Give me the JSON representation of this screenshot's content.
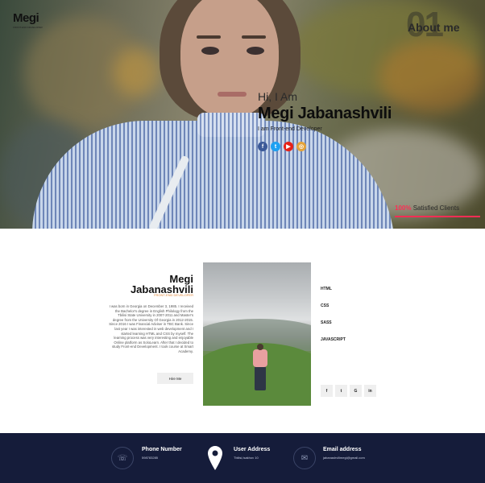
{
  "brand": {
    "name": "Megi",
    "subtitle": "FRONT-END DEVELOPER"
  },
  "hero": {
    "section_number": "01",
    "section_title": "About me",
    "greeting": "Hi, I Am",
    "name": "Megi Jabanashvili",
    "role": "I am Front-end Developer",
    "stat_value": "100%",
    "stat_label": "Satisfied Clients"
  },
  "social_icons": [
    "facebook-icon",
    "twitter-icon",
    "youtube-icon",
    "rss-icon"
  ],
  "about": {
    "name": "Megi Jabanashvili",
    "role": "FRONT-END DEVELOPER",
    "bio": "I was born in Georgia on December 3, 1985. I received the Bachelor's degree in English Philology from the Tbilisi State University in 2007-2011 and Master's degree from the University Of Georgia in 2012-2015. Since 2016 I was Financial Adviser in TBC Bank. Since last year I was interested in web development and I started learning HTML and CSS by myself. The learning process was very interesting and enjoyable Online platform as SoloLearn. After that I decided to study Front-end Development. I took course at Smart Academy.",
    "hire_label": "Hire Me",
    "skills": [
      "HTML",
      "CSS",
      "SASS",
      "JAVASCRIPT"
    ],
    "mini_socials": [
      "f",
      "t",
      "G",
      "in"
    ]
  },
  "footer": {
    "phone_title": "Phone Number",
    "phone_value": "598783285",
    "address_title": "User Address",
    "address_value": "Tbilisi,Isakhov 10",
    "email_title": "Email address",
    "email_value": "jabanashvilimegi@gmail.com"
  },
  "colors": {
    "accent": "#ff2d55",
    "footer_bg": "#151c3a"
  }
}
